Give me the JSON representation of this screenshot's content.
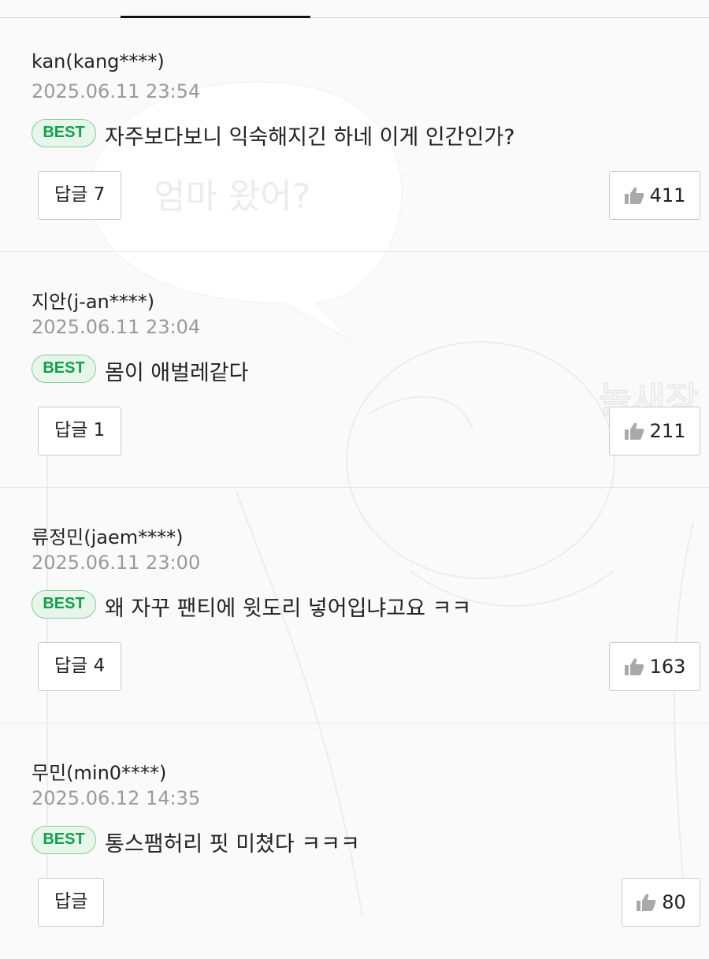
{
  "colors": {
    "best_badge_text": "#12a04a",
    "best_badge_bg": "#e6f6ea",
    "best_badge_border": "#7fcf95",
    "date_text": "#9a9a9a",
    "tab_indicator": "#111111"
  },
  "background_art": {
    "speech_bubble_text": "엄마 왔어?"
  },
  "comments": [
    {
      "author": "kan(kang****)",
      "date": "2025.06.11 23:54",
      "badge": "BEST",
      "text": "자주보다보니 익숙해지긴 하네 이게 인간인가?",
      "reply_label": "답글 7",
      "likes": "411",
      "like_icon": "thumbs-up-icon"
    },
    {
      "author": "지안(j-an****)",
      "date": "2025.06.11 23:04",
      "badge": "BEST",
      "text": "몸이 애벌레같다",
      "reply_label": "답글 1",
      "likes": "211",
      "like_icon": "thumbs-up-icon"
    },
    {
      "author": "류정민(jaem****)",
      "date": "2025.06.11 23:00",
      "badge": "BEST",
      "text": "왜 자꾸 팬티에 윗도리 넣어입냐고요 ㅋㅋ",
      "reply_label": "답글 4",
      "likes": "163",
      "like_icon": "thumbs-up-icon"
    },
    {
      "author": "무민(min0****)",
      "date": "2025.06.12 14:35",
      "badge": "BEST",
      "text": "통스팸허리 핏 미쳤다 ㅋㅋㅋ",
      "reply_label": "답글",
      "likes": "80",
      "like_icon": "thumbs-up-icon"
    }
  ]
}
